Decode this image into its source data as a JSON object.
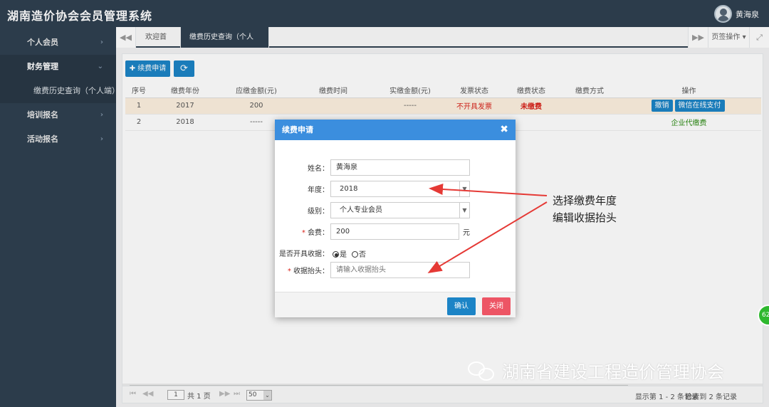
{
  "app": {
    "title": "湖南造价协会会员管理系统",
    "user_name": "黄海泉"
  },
  "sidebar": {
    "items": [
      {
        "label": "个人会员",
        "arrow": "›"
      },
      {
        "label": "财务管理",
        "arrow": "⌄"
      },
      {
        "label": "缴费历史查询（个人端）"
      },
      {
        "label": "培训报名",
        "arrow": "›"
      },
      {
        "label": "活动报名",
        "arrow": "›"
      }
    ]
  },
  "tabs": {
    "prev_icon": "◀◀",
    "items": [
      {
        "label": "欢迎首页"
      },
      {
        "label": "缴费历史查询（个人端）",
        "close": "✖"
      }
    ],
    "next_icon": "▶▶",
    "ops_label": "页签操作 ▾",
    "fullscreen_icon": "⤢"
  },
  "toolbar": {
    "renew_label": "✚ 续费申请",
    "refresh_icon": "⟳"
  },
  "table": {
    "headers": [
      "序号",
      "缴费年份",
      "应缴金额(元)",
      "缴费时间",
      "实缴金额(元)",
      "发票状态",
      "缴费状态",
      "缴费方式",
      "操作"
    ],
    "rows": [
      {
        "no": "1",
        "year": "2017",
        "due": "200",
        "time": "",
        "paid": "-----",
        "invoice": "不开具发票",
        "status": "未缴费",
        "method": "",
        "op1": "撤销",
        "op2": "微信在线支付"
      },
      {
        "no": "2",
        "year": "2018",
        "due": "-----",
        "time": "",
        "paid": "",
        "invoice": "",
        "status": "",
        "method": "",
        "op_text": "企业代缴费"
      }
    ]
  },
  "pager": {
    "first": "⏮",
    "prev": "◀◀",
    "page": "1",
    "total": "共 1 页",
    "next": "▶▶",
    "last": "⏭",
    "size": "50",
    "info": "显示第 1 - 2 条记录",
    "info2": "检索到 2 条记录"
  },
  "modal": {
    "title": "续费申请",
    "close": "✖",
    "name_label": "姓名：",
    "name_value": "黄海泉",
    "year_label": "年度：",
    "year_value": "2018",
    "level_label": "级别：",
    "level_value": "个人专业会员",
    "fee_label": "会费：",
    "fee_value": "200",
    "fee_unit": "元",
    "receipt_label": "是否开具收据：",
    "receipt_yes": "是",
    "receipt_no": "否",
    "header_label": "收据抬头：",
    "header_placeholder": "请输入收据抬头",
    "ok_label": "确认",
    "close_label": "关闭",
    "required_mark": "*"
  },
  "annotation": {
    "line1": "选择缴费年度",
    "line2": "编辑收据抬头",
    "color": "#e53935"
  },
  "watermark": {
    "text": "湖南省建设工程造价管理协会"
  },
  "side_badge": {
    "text": "62"
  }
}
